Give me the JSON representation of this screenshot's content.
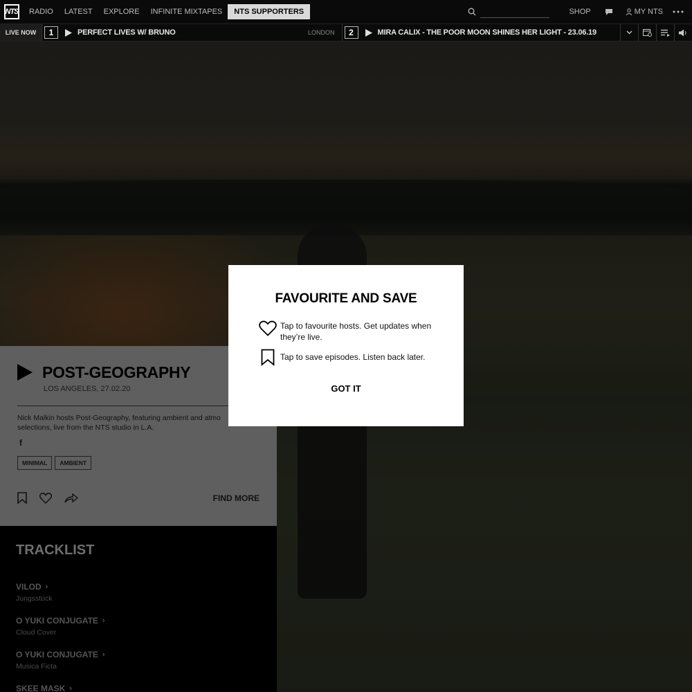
{
  "topnav": {
    "logo_text": "NTS",
    "links": [
      "RADIO",
      "LATEST",
      "EXPLORE",
      "INFINITE MIXTAPES",
      "NTS SUPPORTERS"
    ],
    "active": "NTS SUPPORTERS",
    "search_value": "",
    "shop_label": "SHOP",
    "my_nts_label": "MY NTS",
    "icons": [
      "search-icon",
      "chat-icon",
      "user-icon",
      "more-icon"
    ]
  },
  "livebar": {
    "label": "LIVE NOW",
    "channels": [
      {
        "number": "1",
        "title": "PERFECT LIVES W/ BRUNO",
        "location": "LONDON"
      },
      {
        "number": "2",
        "title": "MIRA CALIX - THE POOR MOON SHINES HER LIGHT - 23.06.19",
        "location": ""
      }
    ],
    "buttons": [
      "chevron-down-icon",
      "schedule-icon",
      "queue-icon",
      "volume-icon"
    ]
  },
  "show": {
    "title": "POST-GEOGRAPHY",
    "meta": "LOS ANGELES, 27.02.20",
    "description": "Nick Malkin hosts Post-Geography, featuring ambient and atmo selections, live from the NTS studio in L.A.",
    "social_icon": "f",
    "tags": [
      "MINIMAL",
      "AMBIENT"
    ],
    "find_more": "FIND MORE"
  },
  "tracklist": {
    "heading": "TRACKLIST",
    "tracks": [
      {
        "artist": "VILOD",
        "title": "Jungsstück"
      },
      {
        "artist": "O YUKI CONJUGATE",
        "title": "Cloud Cover"
      },
      {
        "artist": "O YUKI CONJUGATE",
        "title": "Musica Ficta"
      },
      {
        "artist": "SKEE MASK",
        "title": ""
      }
    ]
  },
  "modal": {
    "title": "FAVOURITE AND SAVE",
    "favourite_text": "Tap to favourite hosts. Get updates when they’re live.",
    "save_text": "Tap to save episodes. Listen back later.",
    "button": "GOT IT"
  },
  "colors": {
    "modal_bg": "#ffffff",
    "panel_bg": "#5f5f5f",
    "nav_bg": "#0a0a0a",
    "active_nav": "#d9d9d9"
  }
}
